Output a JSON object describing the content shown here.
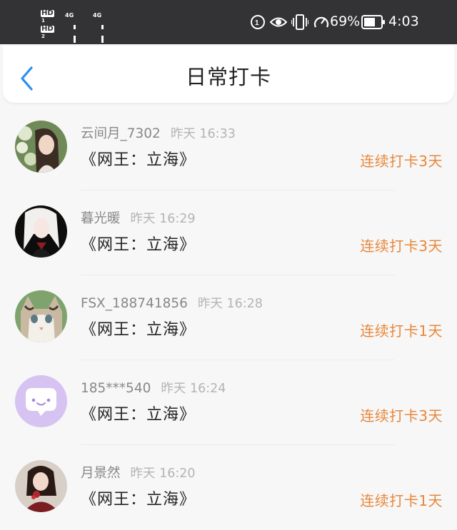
{
  "status_bar": {
    "sim1": "HD",
    "sim1_sub": "1",
    "sim2": "HD",
    "sim2_sub": "2",
    "net1": "4G",
    "net2": "4G",
    "battery": "69%",
    "time": "4:03"
  },
  "header": {
    "title": "日常打卡"
  },
  "items": [
    {
      "name": "云间月_7302",
      "time": "昨天 16:33",
      "book": "《网王：立海》",
      "streak": "连续打卡3天"
    },
    {
      "name": "暮光暖",
      "time": "昨天 16:29",
      "book": "《网王：立海》",
      "streak": "连续打卡3天"
    },
    {
      "name": "FSX_188741856",
      "time": "昨天 16:28",
      "book": "《网王：立海》",
      "streak": "连续打卡1天"
    },
    {
      "name": "185***540",
      "time": "昨天 16:24",
      "book": "《网王：立海》",
      "streak": "连续打卡3天"
    },
    {
      "name": "月景然",
      "time": "昨天 16:20",
      "book": "《网王：立海》",
      "streak": "连续打卡1天"
    }
  ],
  "colors": {
    "status_bar_bg": "#333335",
    "accent_blue": "#2a8ff0",
    "streak_orange": "#e8873a"
  }
}
